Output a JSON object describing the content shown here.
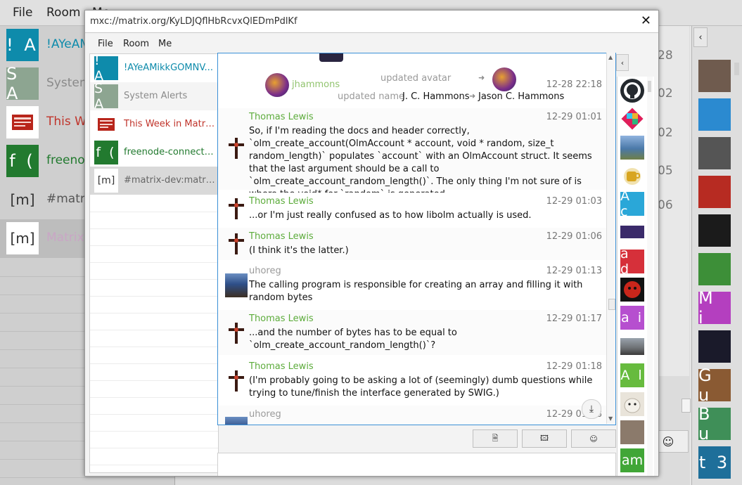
{
  "background": {
    "menu": [
      "File",
      "Room",
      "Me"
    ],
    "rooms": [
      {
        "initials": "! A",
        "name": "!AYeAM",
        "bg": "#0e8bab",
        "fg": "#0e8bab"
      },
      {
        "initials": "S A",
        "name": "System",
        "bg": "#8da591",
        "fg": "#8a8a8a"
      },
      {
        "initials": "",
        "name": "This W",
        "bg": "#ffffff",
        "fg": "#c0342b"
      },
      {
        "initials": "f (",
        "name": "freenod",
        "bg": "#227a2f",
        "fg": "#227a2f"
      },
      {
        "initials": "[m]",
        "name": "#matri",
        "bg": "#ffffff",
        "fg": "#555555"
      },
      {
        "initials": "[m]",
        "name": "Matrix",
        "bg": "#ffffff",
        "fg": "#c9a6c5"
      }
    ],
    "center_numbers": [
      "28",
      "02",
      "02",
      "05",
      "06"
    ],
    "members": [
      {
        "initials": "",
        "bg": "#6f5b4e"
      },
      {
        "initials": "",
        "bg": "#2b8ad0"
      },
      {
        "initials": "",
        "bg": "#555555"
      },
      {
        "initials": "",
        "bg": "#b72b22"
      },
      {
        "initials": "",
        "bg": "#1b1b1b"
      },
      {
        "initials": "",
        "bg": "#3d8f38"
      },
      {
        "initials": "M i",
        "bg": "#b43fbf"
      },
      {
        "initials": "",
        "bg": "#1a1a2a"
      },
      {
        "initials": "G u",
        "bg": "#8a5a33"
      },
      {
        "initials": "B u",
        "bg": "#3f8f58"
      },
      {
        "initials": "t 3",
        "bg": "#1e6f9a"
      }
    ],
    "emoji_button": "☺"
  },
  "dialog": {
    "title": "mxc://matrix.org/KyLDJQflHbRcvxQlEDmPdlKf",
    "close_label": "✕",
    "menu": [
      "File",
      "Room",
      "Me"
    ],
    "rooms": [
      {
        "initials": "! A",
        "name": "!AYeAMikkGOMNV...",
        "bg": "#0e8bab",
        "fg": "#0e8bab"
      },
      {
        "initials": "S A",
        "name": "System Alerts",
        "bg": "#8da591",
        "fg": "#8a8a8a"
      },
      {
        "initials": "",
        "name": "This Week in Matri...",
        "bg": "#ffffff",
        "fg": "#c0342b"
      },
      {
        "initials": "f (",
        "name": "freenode-connect (...",
        "bg": "#227a2f",
        "fg": "#227a2f"
      },
      {
        "initials": "[m]",
        "name": "#matrix-dev:matrix...",
        "bg": "#ffffff",
        "fg": "#666666"
      }
    ],
    "state_event": {
      "sender": "jhammons",
      "action_avatar": "updated avatar",
      "action_name": "updated name",
      "old_name": "J. C. Hammons",
      "new_name": "Jason C. Hammons",
      "time": "12-28 22:18"
    },
    "messages": [
      {
        "sender": "Thomas Lewis",
        "time": "12-29 01:01",
        "color": "#5dac3c",
        "body": "So, if I'm reading the docs and header correctly, `olm_create_account(OlmAccount * account, void * random, size_t random_length)` populates `account` with an OlmAccount struct. It seems that the last argument should be a call to `olm_create_account_random_length()`. The only thing I'm not sure of is where the void* for `random` is generated."
      },
      {
        "sender": "Thomas Lewis",
        "time": "12-29 01:03",
        "color": "#5dac3c",
        "body": "...or I'm just really confused as to how libolm actually is used."
      },
      {
        "sender": "Thomas Lewis",
        "time": "12-29 01:06",
        "color": "#5dac3c",
        "body": "(I think it's the latter.)"
      },
      {
        "sender": "uhoreg",
        "time": "12-29 01:13",
        "color": "#9a9a9a",
        "body": "The calling program is responsible for creating an array and filling it with random bytes"
      },
      {
        "sender": "Thomas Lewis",
        "time": "12-29 01:17",
        "color": "#5dac3c",
        "body": "...and the number of bytes has to be equal to `olm_create_account_random_length()`?"
      },
      {
        "sender": "Thomas Lewis",
        "time": "12-29 01:18",
        "color": "#5dac3c",
        "body": "(I'm probably going to be asking a lot of (seemingly) dumb questions while trying to tune/finish the interface generated by SWIG.)"
      },
      {
        "sender": "uhoreg",
        "time": "12-29 01:18",
        "color": "#9a9a9a",
        "body": ""
      }
    ],
    "members": [
      {
        "initials": "",
        "bg": "#24292e"
      },
      {
        "initials": "",
        "bg": "#e01e5a"
      },
      {
        "initials": "",
        "bg": "#4a78a8"
      },
      {
        "initials": "",
        "bg": "#f1e2b0"
      },
      {
        "initials": "A c",
        "bg": "#2aa7d8"
      },
      {
        "initials": "",
        "bg": "#3a2a6a"
      },
      {
        "initials": "a d",
        "bg": "#d6303a"
      },
      {
        "initials": "",
        "bg": "#111111"
      },
      {
        "initials": "a i",
        "bg": "#b64fcf"
      },
      {
        "initials": "",
        "bg": "#6c6f72"
      },
      {
        "initials": "A l",
        "bg": "#67bb3e"
      },
      {
        "initials": "",
        "bg": "#e9e4da"
      },
      {
        "initials": "",
        "bg": "#8b7a6b"
      },
      {
        "initials": "am",
        "bg": "#41a637"
      }
    ],
    "toolbar": {
      "file": "🗎",
      "image": "🖾",
      "emoji": "☺"
    },
    "download_icon": "⤓",
    "collapse_icon": "‹"
  }
}
